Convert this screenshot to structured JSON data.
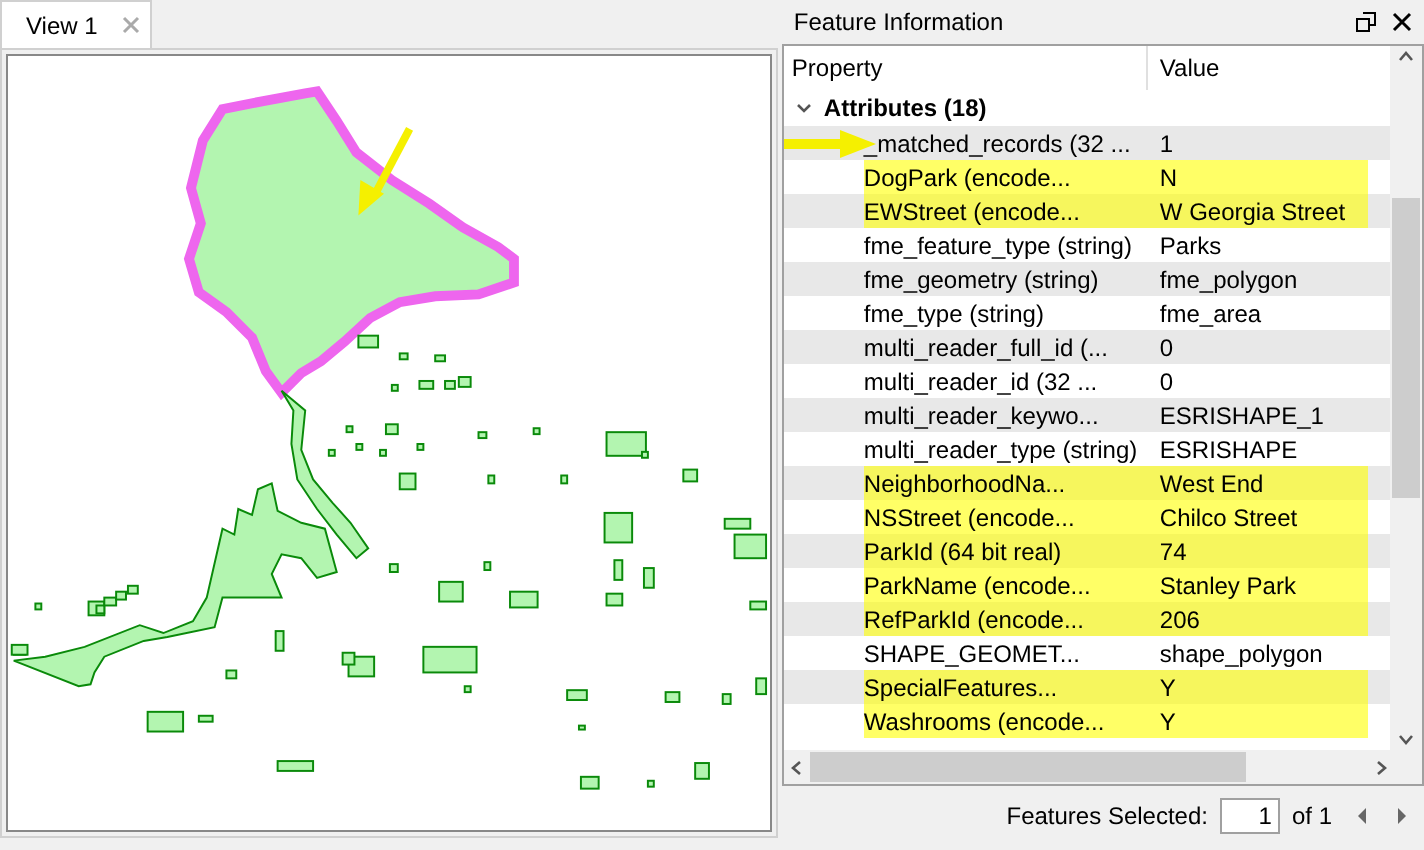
{
  "view_tab": {
    "label": "View 1",
    "selected": true
  },
  "panel": {
    "title": "Feature Information"
  },
  "table": {
    "columns": [
      "Property",
      "Value"
    ],
    "group": {
      "label": "Attributes (18)",
      "expanded": true
    },
    "rows": [
      {
        "property": "_matched_records (32 ...",
        "value": "1",
        "highlighted": false
      },
      {
        "property": "DogPark (encode...",
        "value": "N",
        "highlighted": true
      },
      {
        "property": "EWStreet (encode...",
        "value": "W Georgia Street",
        "highlighted": true
      },
      {
        "property": "fme_feature_type (string)",
        "value": "Parks",
        "highlighted": false
      },
      {
        "property": "fme_geometry (string)",
        "value": "fme_polygon",
        "highlighted": false
      },
      {
        "property": "fme_type (string)",
        "value": "fme_area",
        "highlighted": false
      },
      {
        "property": "multi_reader_full_id (...",
        "value": "0",
        "highlighted": false
      },
      {
        "property": "multi_reader_id (32 ...",
        "value": "0",
        "highlighted": false
      },
      {
        "property": "multi_reader_keywo...",
        "value": "ESRISHAPE_1",
        "highlighted": false
      },
      {
        "property": "multi_reader_type (string)",
        "value": "ESRISHAPE",
        "highlighted": false
      },
      {
        "property": "NeighborhoodNa...",
        "value": "West End",
        "highlighted": true
      },
      {
        "property": "NSStreet (encode...",
        "value": "Chilco Street",
        "highlighted": true
      },
      {
        "property": "ParkId (64 bit real)",
        "value": "74",
        "highlighted": true
      },
      {
        "property": "ParkName (encode...",
        "value": "Stanley Park",
        "highlighted": true
      },
      {
        "property": "RefParkId (encode...",
        "value": "206",
        "highlighted": true
      },
      {
        "property": "SHAPE_GEOMET...",
        "value": "shape_polygon",
        "highlighted": false
      },
      {
        "property": "SpecialFeatures...",
        "value": "Y",
        "highlighted": true
      },
      {
        "property": "Washrooms (encode...",
        "value": "Y",
        "highlighted": true
      }
    ]
  },
  "footer": {
    "label": "Features Selected:",
    "value": "1",
    "total": "of 1"
  }
}
